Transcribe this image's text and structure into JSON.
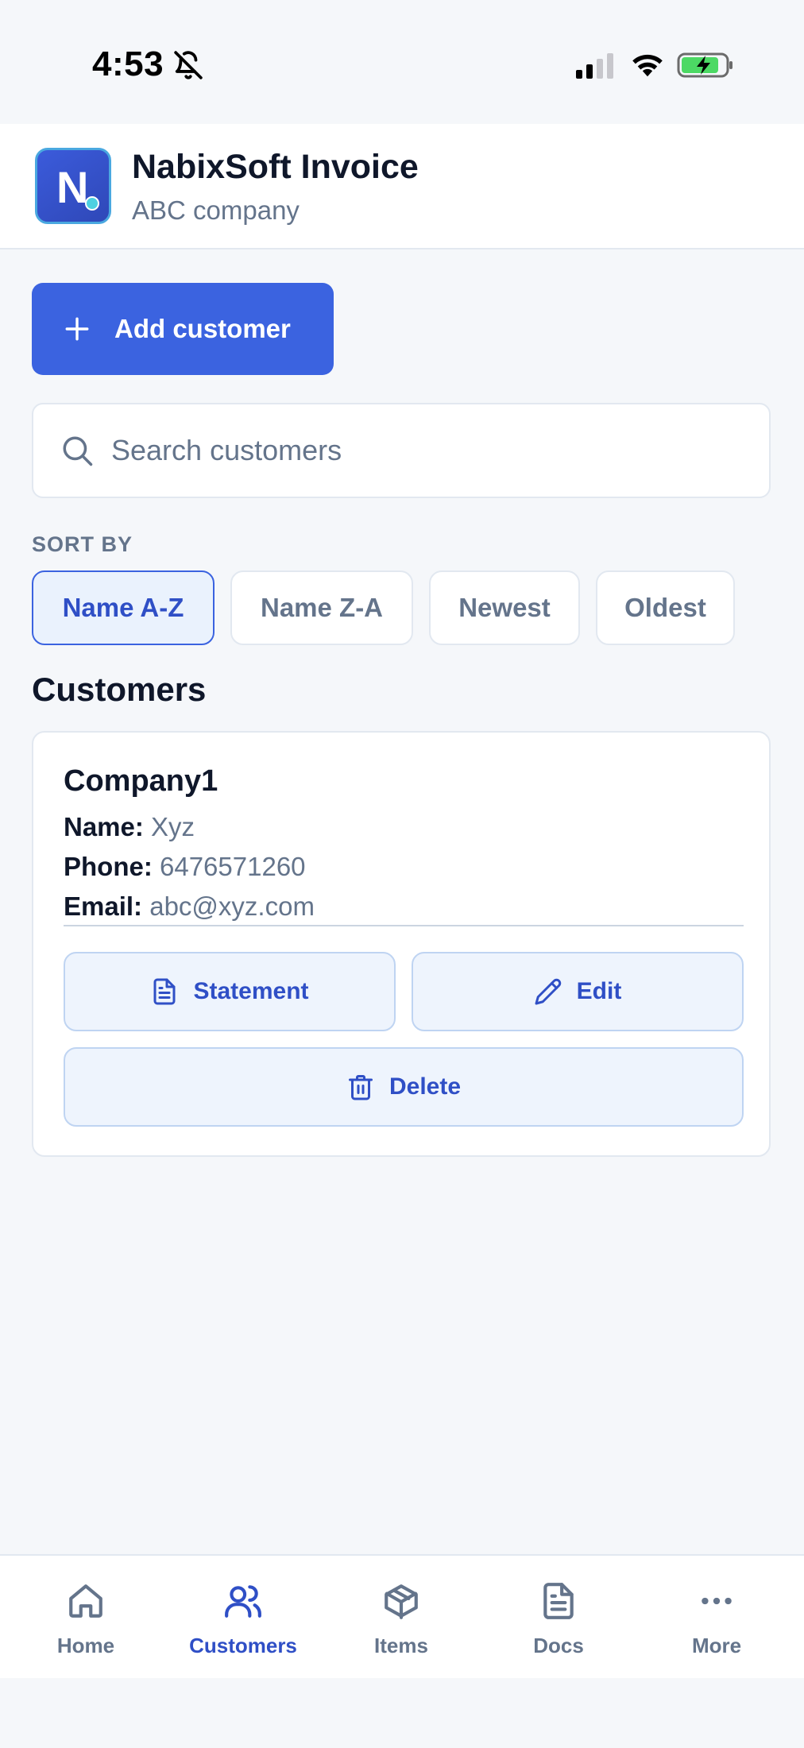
{
  "status_bar": {
    "time": "4:53",
    "icons": [
      "bell-off-icon",
      "signal-icon",
      "wifi-icon",
      "battery-charging-icon"
    ]
  },
  "header": {
    "logo_letter": "N",
    "title": "NabixSoft Invoice",
    "subtitle": "ABC company"
  },
  "actions": {
    "add_customer_label": "Add customer"
  },
  "search": {
    "placeholder": "Search customers",
    "value": ""
  },
  "sort": {
    "label": "SORT BY",
    "options": [
      "Name A-Z",
      "Name Z-A",
      "Newest",
      "Oldest"
    ],
    "selected": "Name A-Z"
  },
  "customers": {
    "section_title": "Customers",
    "items": [
      {
        "company": "Company1",
        "name_label": "Name:",
        "name": "Xyz",
        "phone_label": "Phone:",
        "phone": "6476571260",
        "email_label": "Email:",
        "email": "abc@xyz.com",
        "statement_label": "Statement",
        "edit_label": "Edit",
        "delete_label": "Delete"
      }
    ]
  },
  "nav": {
    "items": [
      {
        "label": "Home",
        "icon": "home-icon"
      },
      {
        "label": "Customers",
        "icon": "users-icon"
      },
      {
        "label": "Items",
        "icon": "box-icon"
      },
      {
        "label": "Docs",
        "icon": "document-icon"
      },
      {
        "label": "More",
        "icon": "more-icon"
      }
    ],
    "active": "Customers"
  },
  "colors": {
    "primary": "#3b63e0",
    "background": "#f5f7fa",
    "text": "#0f172a",
    "muted": "#64748b"
  }
}
